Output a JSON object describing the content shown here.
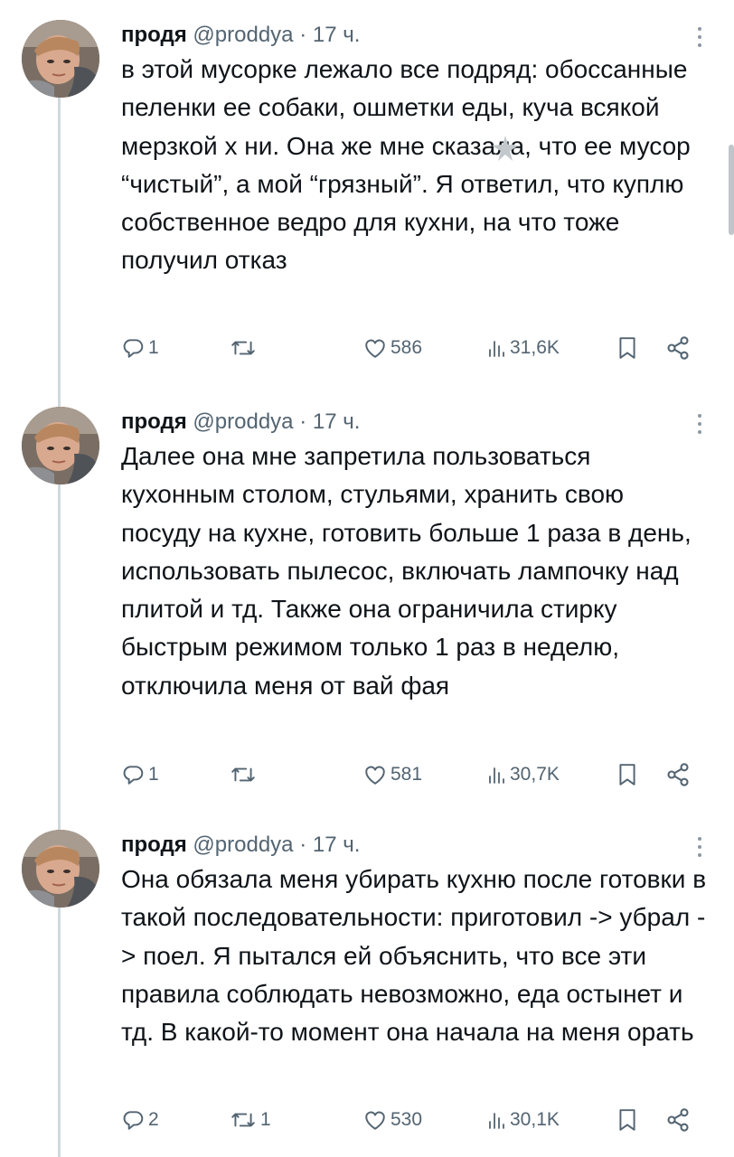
{
  "tweets": [
    {
      "name": "продя",
      "handle": "@proddya",
      "dot": "·",
      "time": "17 ч.",
      "text": "в этой мусорке лежало все подряд: обоссанные пеленки ее собаки, ошметки еды, куча всякой мерзкой х  ни. Она же мне сказала, что ее мусор “чистый”, а мой “грязный”. Я ответил, что куплю собственное ведро для кухни, на что тоже получил отказ",
      "replies": "1",
      "retweets": "",
      "likes": "586",
      "views": "31,6K"
    },
    {
      "name": "продя",
      "handle": "@proddya",
      "dot": "·",
      "time": "17 ч.",
      "text": "Далее она мне запретила пользоваться кухонным столом, стульями, хранить свою посуду на кухне, готовить больше 1 раза в день, использовать пылесос, включать лампочку над плитой и тд. Также она ограничила стирку быстрым режимом только 1 раз в неделю, отключила меня от вай фая",
      "replies": "1",
      "retweets": "",
      "likes": "581",
      "views": "30,7K"
    },
    {
      "name": "продя",
      "handle": "@proddya",
      "dot": "·",
      "time": "17 ч.",
      "text": "Она обязала меня убирать кухню после готовки в такой последовательности: приготовил -> убрал -> поел. Я пытался ей объяснить, что все эти правила соблюдать невозможно, еда остынет и тд. В какой-то момент она начала на меня орать",
      "replies": "2",
      "retweets": "1",
      "likes": "530",
      "views": "30,1K"
    }
  ],
  "icons": {
    "reply": "reply-icon",
    "retweet": "retweet-icon",
    "like": "heart-icon",
    "views": "views-icon",
    "bookmark": "bookmark-icon",
    "share": "share-icon",
    "more": "more-icon"
  },
  "colors": {
    "text": "#0f1419",
    "secondary": "#536471",
    "thread_line": "#cfd9de"
  }
}
